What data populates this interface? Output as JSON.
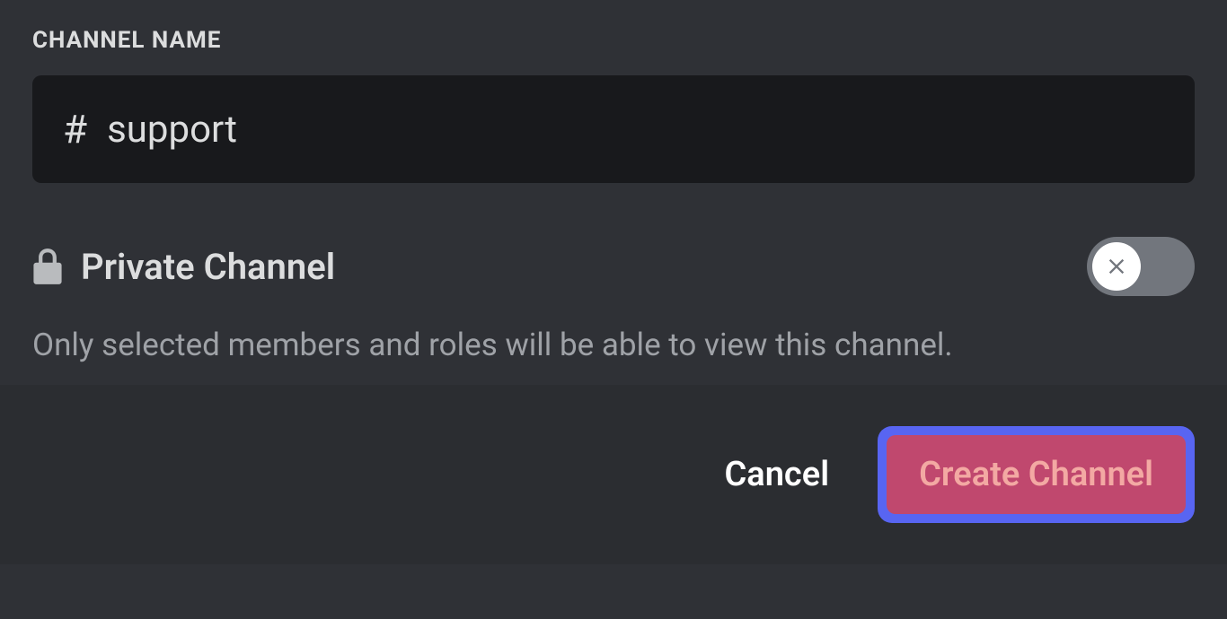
{
  "form": {
    "channel_name_label": "CHANNEL NAME",
    "channel_name_value": "support",
    "private": {
      "label": "Private Channel",
      "description": "Only selected members and roles will be able to view this channel.",
      "enabled": false
    }
  },
  "footer": {
    "cancel_label": "Cancel",
    "create_label": "Create Channel"
  }
}
